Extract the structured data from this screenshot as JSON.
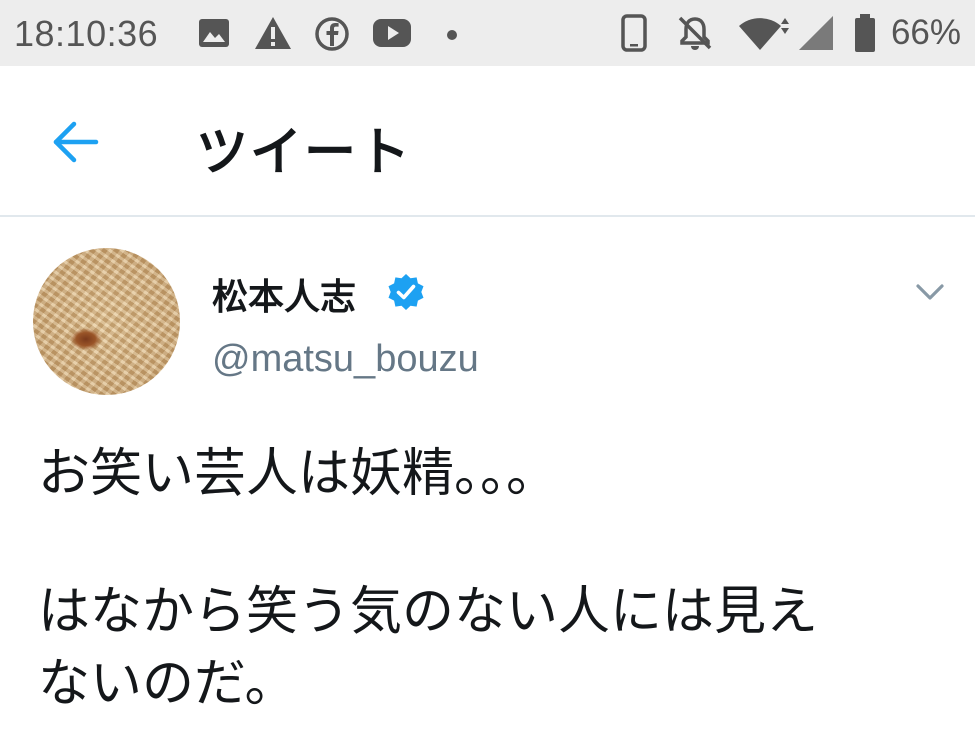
{
  "status_bar": {
    "time": "18:10:36",
    "battery_percent": "66%",
    "left_icons": [
      "image-icon",
      "warning-icon",
      "facebook-icon",
      "youtube-icon",
      "dot-icon"
    ],
    "right_icons": [
      "phone-icon",
      "notifications-off-icon",
      "wifi-icon",
      "signal-icon",
      "battery-icon"
    ]
  },
  "header": {
    "title": "ツイート",
    "back_icon": "arrow-left-icon"
  },
  "tweet": {
    "display_name": "松本人志",
    "verified": true,
    "handle": "@matsu_bouzu",
    "text_lines": [
      "お笑い芸人は妖精。。。",
      "",
      "はなから笑う気のない人には見え",
      "ないのだ。"
    ]
  },
  "colors": {
    "accent": "#1da1f2",
    "status_bar_bg": "#ededed",
    "text_primary": "#14171a",
    "text_secondary": "#657786",
    "divider": "#e1e8ed"
  }
}
